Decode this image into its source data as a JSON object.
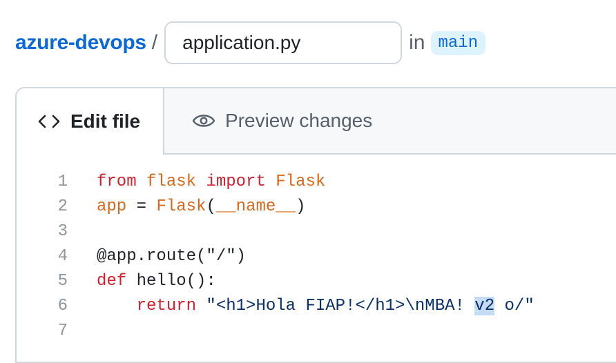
{
  "breadcrumb": {
    "repo": "azure-devops",
    "separator": "/",
    "filename": "application.py",
    "in_label": "in",
    "branch": "main"
  },
  "tabs": {
    "edit": "Edit file",
    "preview": "Preview changes"
  },
  "icons": {
    "edit": "code-icon",
    "preview": "eye-icon"
  },
  "code": {
    "line_numbers": [
      "1",
      "2",
      "3",
      "4",
      "5",
      "6",
      "7"
    ],
    "l1": {
      "kw1": "from",
      "mod": "flask",
      "kw2": "import",
      "cls": "Flask"
    },
    "l2": {
      "var": "app",
      "op": " = ",
      "call": "Flask",
      "open": "(",
      "arg": "__name__",
      "close": ")"
    },
    "l4": {
      "text": "@app.route(\"/\")"
    },
    "l5": {
      "kw": "def",
      "rest": " hello():"
    },
    "l6": {
      "indent": "    ",
      "kw": "return",
      "str_a": " \"<h1>Hola FIAP!</h1>\\nMBA! ",
      "sel": "v2",
      "str_b": " o/\""
    }
  },
  "colors": {
    "link": "#0969da",
    "keyword": "#cf222e",
    "name": "#d4691e",
    "selection": "#c6dcf5"
  }
}
